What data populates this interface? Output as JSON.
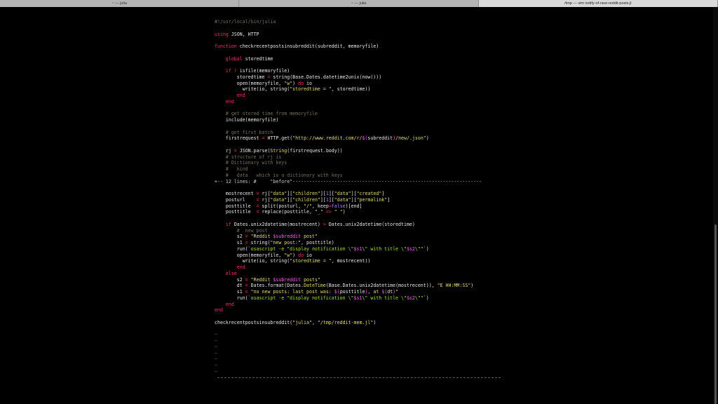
{
  "tabs": [
    {
      "label": "~ — julia"
    },
    {
      "label": "~ — julia"
    },
    {
      "label": "/tmp — vim notify-of-new-reddit-posts.jl"
    }
  ],
  "editor": {
    "lines": [
      [
        {
          "t": "#!/usr/local/bin/julia",
          "c": "cm"
        }
      ],
      [],
      [
        {
          "t": "using",
          "c": "kw"
        },
        {
          "t": " JSON, HTTP"
        }
      ],
      [],
      [
        {
          "t": "function",
          "c": "kw"
        },
        {
          "t": " checkrecentpostsinsubreddit(subreddit, memoryfile)"
        }
      ],
      [],
      [
        {
          "t": "    "
        },
        {
          "t": "global",
          "c": "kw"
        },
        {
          "t": " storedtime"
        }
      ],
      [],
      [
        {
          "t": "    "
        },
        {
          "t": "if",
          "c": "kw"
        },
        {
          "t": " "
        },
        {
          "t": "!",
          "c": "kw"
        },
        {
          "t": " isfile(memoryfile)"
        }
      ],
      [
        {
          "t": "        storedtime "
        },
        {
          "t": "=",
          "c": "kw"
        },
        {
          "t": " string(Base.Dates.datetime2unix(now()))"
        }
      ],
      [
        {
          "t": "        open(memoryfile, "
        },
        {
          "t": "\"w\"",
          "c": "str"
        },
        {
          "t": ") "
        },
        {
          "t": "do",
          "c": "kw"
        },
        {
          "t": " io"
        }
      ],
      [
        {
          "t": "          write(io, string("
        },
        {
          "t": "\"storedtime = \"",
          "c": "str"
        },
        {
          "t": ", storedtime))"
        }
      ],
      [
        {
          "t": "        "
        },
        {
          "t": "end",
          "c": "kw"
        }
      ],
      [
        {
          "t": "    "
        },
        {
          "t": "end",
          "c": "kw"
        }
      ],
      [],
      [
        {
          "t": "    "
        },
        {
          "t": "# get stored time from memoryfile",
          "c": "cm"
        }
      ],
      [
        {
          "t": "    include(memoryfile)"
        }
      ],
      [],
      [
        {
          "t": "    "
        },
        {
          "t": "# get first batch",
          "c": "cm"
        }
      ],
      [
        {
          "t": "    firstrequest "
        },
        {
          "t": "=",
          "c": "kw"
        },
        {
          "t": " HTTP.get("
        },
        {
          "t": "\"http://www.reddit.com/r/",
          "c": "str"
        },
        {
          "t": "$(",
          "c": "sym"
        },
        {
          "t": "subreddit"
        },
        {
          "t": ")",
          "c": "sym"
        },
        {
          "t": "/new/.json\"",
          "c": "str"
        },
        {
          "t": ")"
        }
      ],
      [],
      [
        {
          "t": "    rj "
        },
        {
          "t": "=",
          "c": "kw"
        },
        {
          "t": " JSON.parse("
        },
        {
          "t": "String",
          "c": "str"
        },
        {
          "t": "(firstrequest.body))"
        }
      ],
      [
        {
          "t": "    "
        },
        {
          "t": "# structure of rj is",
          "c": "cm"
        }
      ],
      [
        {
          "t": "    "
        },
        {
          "t": "# Dictionary with keys",
          "c": "cm"
        }
      ],
      [
        {
          "t": "    "
        },
        {
          "t": "#   kind",
          "c": "cm"
        }
      ],
      [
        {
          "t": "    "
        },
        {
          "t": "#   data   which is a dictionary with keys",
          "c": "cm"
        }
      ],
      [
        {
          "t": "+-- 12 lines: #     \"before\"--------------------------------------------------------------------",
          "c": "fold"
        }
      ],
      [],
      [
        {
          "t": "    mostrecent "
        },
        {
          "t": "=",
          "c": "kw"
        },
        {
          "t": " rj["
        },
        {
          "t": "\"data\"",
          "c": "str"
        },
        {
          "t": "]["
        },
        {
          "t": "\"children\"",
          "c": "str"
        },
        {
          "t": "]["
        },
        {
          "t": "1",
          "c": "num"
        },
        {
          "t": "]["
        },
        {
          "t": "\"data\"",
          "c": "str"
        },
        {
          "t": "]["
        },
        {
          "t": "\"created\"",
          "c": "str"
        },
        {
          "t": "]"
        }
      ],
      [
        {
          "t": "    posturl    "
        },
        {
          "t": "=",
          "c": "kw"
        },
        {
          "t": " rj["
        },
        {
          "t": "\"data\"",
          "c": "str"
        },
        {
          "t": "]["
        },
        {
          "t": "\"children\"",
          "c": "str"
        },
        {
          "t": "]["
        },
        {
          "t": "1",
          "c": "num"
        },
        {
          "t": "]["
        },
        {
          "t": "\"data\"",
          "c": "str"
        },
        {
          "t": "]["
        },
        {
          "t": "\"permalink\"",
          "c": "str"
        },
        {
          "t": "]"
        }
      ],
      [
        {
          "t": "    posttitle  "
        },
        {
          "t": "=",
          "c": "kw"
        },
        {
          "t": " split(posturl, "
        },
        {
          "t": "\"/\"",
          "c": "str"
        },
        {
          "t": ", keep"
        },
        {
          "t": "=",
          "c": "kw"
        },
        {
          "t": "false",
          "c": "num"
        },
        {
          "t": ")[end]"
        }
      ],
      [
        {
          "t": "    posttitle  "
        },
        {
          "t": "=",
          "c": "kw"
        },
        {
          "t": " replace(posttitle, "
        },
        {
          "t": "\"_\"",
          "c": "str"
        },
        {
          "t": " "
        },
        {
          "t": "=>",
          "c": "kw"
        },
        {
          "t": " "
        },
        {
          "t": "\" \"",
          "c": "str"
        },
        {
          "t": ")"
        }
      ],
      [],
      [
        {
          "t": "    "
        },
        {
          "t": "if",
          "c": "kw"
        },
        {
          "t": " Dates.unix2datetime(mostrecent) "
        },
        {
          "t": ">",
          "c": "kw"
        },
        {
          "t": " Dates.unix2datetime(storedtime)"
        }
      ],
      [
        {
          "t": "        "
        },
        {
          "t": "#  new post",
          "c": "cm"
        }
      ],
      [
        {
          "t": "        s2 "
        },
        {
          "t": "=",
          "c": "kw"
        },
        {
          "t": " "
        },
        {
          "t": "\"Reddit ",
          "c": "str"
        },
        {
          "t": "$subreddit",
          "c": "sym"
        },
        {
          "t": " post\"",
          "c": "str"
        }
      ],
      [
        {
          "t": "        s1 "
        },
        {
          "t": "=",
          "c": "kw"
        },
        {
          "t": " string("
        },
        {
          "t": "\"new post:\"",
          "c": "str"
        },
        {
          "t": ", posttitle)"
        }
      ],
      [
        {
          "t": "        run("
        },
        {
          "t": "`osascript -e \"display notification \\\"",
          "c": "bt"
        },
        {
          "t": "$s1",
          "c": "sym"
        },
        {
          "t": "\\\" with title \\\"",
          "c": "bt"
        },
        {
          "t": "$s2",
          "c": "sym"
        },
        {
          "t": "\\\"\"`",
          "c": "bt"
        },
        {
          "t": ")"
        }
      ],
      [
        {
          "t": "        open(memoryfile, "
        },
        {
          "t": "\"w\"",
          "c": "str"
        },
        {
          "t": ") "
        },
        {
          "t": "do",
          "c": "kw"
        },
        {
          "t": " io"
        }
      ],
      [
        {
          "t": "          write(io, string("
        },
        {
          "t": "\"storedtime = \"",
          "c": "str"
        },
        {
          "t": ", mostrecent))"
        }
      ],
      [
        {
          "t": "        "
        },
        {
          "t": "end",
          "c": "kw"
        }
      ],
      [
        {
          "t": "    "
        },
        {
          "t": "else",
          "c": "kw"
        }
      ],
      [
        {
          "t": "        s2 "
        },
        {
          "t": "=",
          "c": "kw"
        },
        {
          "t": " "
        },
        {
          "t": "\"Reddit ",
          "c": "str"
        },
        {
          "t": "$subreddit",
          "c": "sym"
        },
        {
          "t": " posts\"",
          "c": "str"
        }
      ],
      [
        {
          "t": "        dt "
        },
        {
          "t": "=",
          "c": "kw"
        },
        {
          "t": " Dates.format(Dates."
        },
        {
          "t": "DateTime",
          "c": "str"
        },
        {
          "t": "(Base.Dates.unix2datetime(mostrecent)), "
        },
        {
          "t": "\"E HH:MM:SS\"",
          "c": "str"
        },
        {
          "t": ")"
        }
      ],
      [
        {
          "t": "        s1 "
        },
        {
          "t": "=",
          "c": "kw"
        },
        {
          "t": " "
        },
        {
          "t": "\"no new posts: last post was: ",
          "c": "str"
        },
        {
          "t": "$(",
          "c": "sym"
        },
        {
          "t": "posttitle"
        },
        {
          "t": ")",
          "c": "sym"
        },
        {
          "t": ", at ",
          "c": "str"
        },
        {
          "t": "$(",
          "c": "sym"
        },
        {
          "t": "dt"
        },
        {
          "t": ")",
          "c": "sym"
        },
        {
          "t": "\"",
          "c": "str"
        }
      ],
      [
        {
          "t": "        run("
        },
        {
          "t": "`osascript -e \"display notification \\\"",
          "c": "bt"
        },
        {
          "t": "$s1",
          "c": "sym"
        },
        {
          "t": "\\\" with title \\\"",
          "c": "bt"
        },
        {
          "t": "$s2",
          "c": "sym"
        },
        {
          "t": "\\\"\"`",
          "c": "bt"
        },
        {
          "t": ")"
        }
      ],
      [
        {
          "t": "    "
        },
        {
          "t": "end",
          "c": "kw"
        }
      ],
      [
        {
          "t": "end",
          "c": "kw"
        }
      ],
      [],
      [
        {
          "t": "checkrecentpostsinsubreddit("
        },
        {
          "t": "\"julia\"",
          "c": "str"
        },
        {
          "t": ", "
        },
        {
          "t": "\"/tmp/reddit-mem.jl\"",
          "c": "str"
        },
        {
          "t": ")"
        }
      ],
      [],
      [
        {
          "t": "~",
          "c": "tilde"
        }
      ],
      [
        {
          "t": "~",
          "c": "tilde"
        }
      ],
      [
        {
          "t": "~",
          "c": "tilde"
        }
      ],
      [
        {
          "t": "~",
          "c": "tilde"
        }
      ],
      [
        {
          "t": "~",
          "c": "tilde"
        }
      ],
      [
        {
          "t": "~",
          "c": "tilde"
        }
      ],
      [
        {
          "t": "~",
          "c": "tilde"
        }
      ]
    ]
  },
  "colors": {
    "background": "#000000",
    "keyword": "#ff2f6e",
    "string": "#e6db74",
    "comment": "#75715e",
    "number": "#ae81ff",
    "interp": "#fd5ff0"
  }
}
